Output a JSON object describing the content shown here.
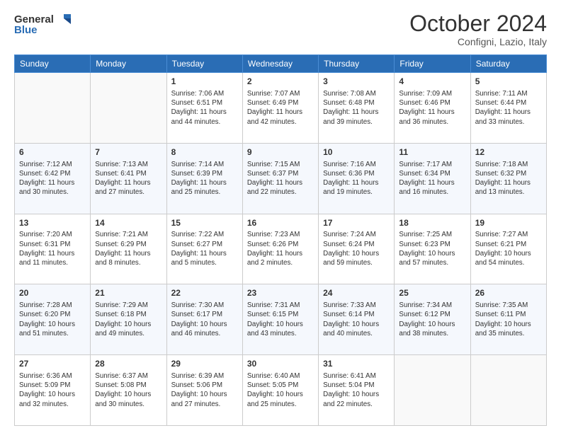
{
  "header": {
    "logo_line1": "General",
    "logo_line2": "Blue",
    "month_title": "October 2024",
    "subtitle": "Configni, Lazio, Italy"
  },
  "days_of_week": [
    "Sunday",
    "Monday",
    "Tuesday",
    "Wednesday",
    "Thursday",
    "Friday",
    "Saturday"
  ],
  "weeks": [
    [
      {
        "day": "",
        "empty": true
      },
      {
        "day": "",
        "empty": true
      },
      {
        "day": "1",
        "sunrise": "Sunrise: 7:06 AM",
        "sunset": "Sunset: 6:51 PM",
        "daylight": "Daylight: 11 hours and 44 minutes."
      },
      {
        "day": "2",
        "sunrise": "Sunrise: 7:07 AM",
        "sunset": "Sunset: 6:49 PM",
        "daylight": "Daylight: 11 hours and 42 minutes."
      },
      {
        "day": "3",
        "sunrise": "Sunrise: 7:08 AM",
        "sunset": "Sunset: 6:48 PM",
        "daylight": "Daylight: 11 hours and 39 minutes."
      },
      {
        "day": "4",
        "sunrise": "Sunrise: 7:09 AM",
        "sunset": "Sunset: 6:46 PM",
        "daylight": "Daylight: 11 hours and 36 minutes."
      },
      {
        "day": "5",
        "sunrise": "Sunrise: 7:11 AM",
        "sunset": "Sunset: 6:44 PM",
        "daylight": "Daylight: 11 hours and 33 minutes."
      }
    ],
    [
      {
        "day": "6",
        "sunrise": "Sunrise: 7:12 AM",
        "sunset": "Sunset: 6:42 PM",
        "daylight": "Daylight: 11 hours and 30 minutes."
      },
      {
        "day": "7",
        "sunrise": "Sunrise: 7:13 AM",
        "sunset": "Sunset: 6:41 PM",
        "daylight": "Daylight: 11 hours and 27 minutes."
      },
      {
        "day": "8",
        "sunrise": "Sunrise: 7:14 AM",
        "sunset": "Sunset: 6:39 PM",
        "daylight": "Daylight: 11 hours and 25 minutes."
      },
      {
        "day": "9",
        "sunrise": "Sunrise: 7:15 AM",
        "sunset": "Sunset: 6:37 PM",
        "daylight": "Daylight: 11 hours and 22 minutes."
      },
      {
        "day": "10",
        "sunrise": "Sunrise: 7:16 AM",
        "sunset": "Sunset: 6:36 PM",
        "daylight": "Daylight: 11 hours and 19 minutes."
      },
      {
        "day": "11",
        "sunrise": "Sunrise: 7:17 AM",
        "sunset": "Sunset: 6:34 PM",
        "daylight": "Daylight: 11 hours and 16 minutes."
      },
      {
        "day": "12",
        "sunrise": "Sunrise: 7:18 AM",
        "sunset": "Sunset: 6:32 PM",
        "daylight": "Daylight: 11 hours and 13 minutes."
      }
    ],
    [
      {
        "day": "13",
        "sunrise": "Sunrise: 7:20 AM",
        "sunset": "Sunset: 6:31 PM",
        "daylight": "Daylight: 11 hours and 11 minutes."
      },
      {
        "day": "14",
        "sunrise": "Sunrise: 7:21 AM",
        "sunset": "Sunset: 6:29 PM",
        "daylight": "Daylight: 11 hours and 8 minutes."
      },
      {
        "day": "15",
        "sunrise": "Sunrise: 7:22 AM",
        "sunset": "Sunset: 6:27 PM",
        "daylight": "Daylight: 11 hours and 5 minutes."
      },
      {
        "day": "16",
        "sunrise": "Sunrise: 7:23 AM",
        "sunset": "Sunset: 6:26 PM",
        "daylight": "Daylight: 11 hours and 2 minutes."
      },
      {
        "day": "17",
        "sunrise": "Sunrise: 7:24 AM",
        "sunset": "Sunset: 6:24 PM",
        "daylight": "Daylight: 10 hours and 59 minutes."
      },
      {
        "day": "18",
        "sunrise": "Sunrise: 7:25 AM",
        "sunset": "Sunset: 6:23 PM",
        "daylight": "Daylight: 10 hours and 57 minutes."
      },
      {
        "day": "19",
        "sunrise": "Sunrise: 7:27 AM",
        "sunset": "Sunset: 6:21 PM",
        "daylight": "Daylight: 10 hours and 54 minutes."
      }
    ],
    [
      {
        "day": "20",
        "sunrise": "Sunrise: 7:28 AM",
        "sunset": "Sunset: 6:20 PM",
        "daylight": "Daylight: 10 hours and 51 minutes."
      },
      {
        "day": "21",
        "sunrise": "Sunrise: 7:29 AM",
        "sunset": "Sunset: 6:18 PM",
        "daylight": "Daylight: 10 hours and 49 minutes."
      },
      {
        "day": "22",
        "sunrise": "Sunrise: 7:30 AM",
        "sunset": "Sunset: 6:17 PM",
        "daylight": "Daylight: 10 hours and 46 minutes."
      },
      {
        "day": "23",
        "sunrise": "Sunrise: 7:31 AM",
        "sunset": "Sunset: 6:15 PM",
        "daylight": "Daylight: 10 hours and 43 minutes."
      },
      {
        "day": "24",
        "sunrise": "Sunrise: 7:33 AM",
        "sunset": "Sunset: 6:14 PM",
        "daylight": "Daylight: 10 hours and 40 minutes."
      },
      {
        "day": "25",
        "sunrise": "Sunrise: 7:34 AM",
        "sunset": "Sunset: 6:12 PM",
        "daylight": "Daylight: 10 hours and 38 minutes."
      },
      {
        "day": "26",
        "sunrise": "Sunrise: 7:35 AM",
        "sunset": "Sunset: 6:11 PM",
        "daylight": "Daylight: 10 hours and 35 minutes."
      }
    ],
    [
      {
        "day": "27",
        "sunrise": "Sunrise: 6:36 AM",
        "sunset": "Sunset: 5:09 PM",
        "daylight": "Daylight: 10 hours and 32 minutes."
      },
      {
        "day": "28",
        "sunrise": "Sunrise: 6:37 AM",
        "sunset": "Sunset: 5:08 PM",
        "daylight": "Daylight: 10 hours and 30 minutes."
      },
      {
        "day": "29",
        "sunrise": "Sunrise: 6:39 AM",
        "sunset": "Sunset: 5:06 PM",
        "daylight": "Daylight: 10 hours and 27 minutes."
      },
      {
        "day": "30",
        "sunrise": "Sunrise: 6:40 AM",
        "sunset": "Sunset: 5:05 PM",
        "daylight": "Daylight: 10 hours and 25 minutes."
      },
      {
        "day": "31",
        "sunrise": "Sunrise: 6:41 AM",
        "sunset": "Sunset: 5:04 PM",
        "daylight": "Daylight: 10 hours and 22 minutes."
      },
      {
        "day": "",
        "empty": true
      },
      {
        "day": "",
        "empty": true
      }
    ]
  ]
}
